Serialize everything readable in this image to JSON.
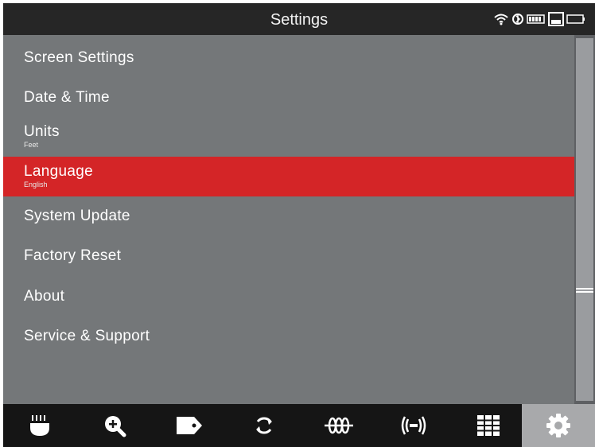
{
  "header": {
    "title": "Settings",
    "status_icons": [
      "wifi-icon",
      "bluetooth-icon",
      "battery-icon",
      "storage-icon",
      "battery-empty-icon"
    ]
  },
  "menu": {
    "items": [
      {
        "label": "Screen Settings",
        "sub": ""
      },
      {
        "label": "Date & Time",
        "sub": ""
      },
      {
        "label": "Units",
        "sub": "Feet"
      },
      {
        "label": "Language",
        "sub": "English",
        "selected": true
      },
      {
        "label": "System Update",
        "sub": ""
      },
      {
        "label": "Factory Reset",
        "sub": ""
      },
      {
        "label": "About",
        "sub": ""
      },
      {
        "label": "Service & Support",
        "sub": ""
      }
    ]
  },
  "toolbar": {
    "tabs": [
      "probe-icon",
      "zoom-in-icon",
      "tag-icon",
      "rotate-icon",
      "coil-icon",
      "signal-icon",
      "grid-icon",
      "settings-gear-icon"
    ],
    "active": "settings-gear-icon"
  },
  "colors": {
    "accent": "#d42527",
    "menu_bg": "#747779",
    "bar_bg": "#151515"
  }
}
